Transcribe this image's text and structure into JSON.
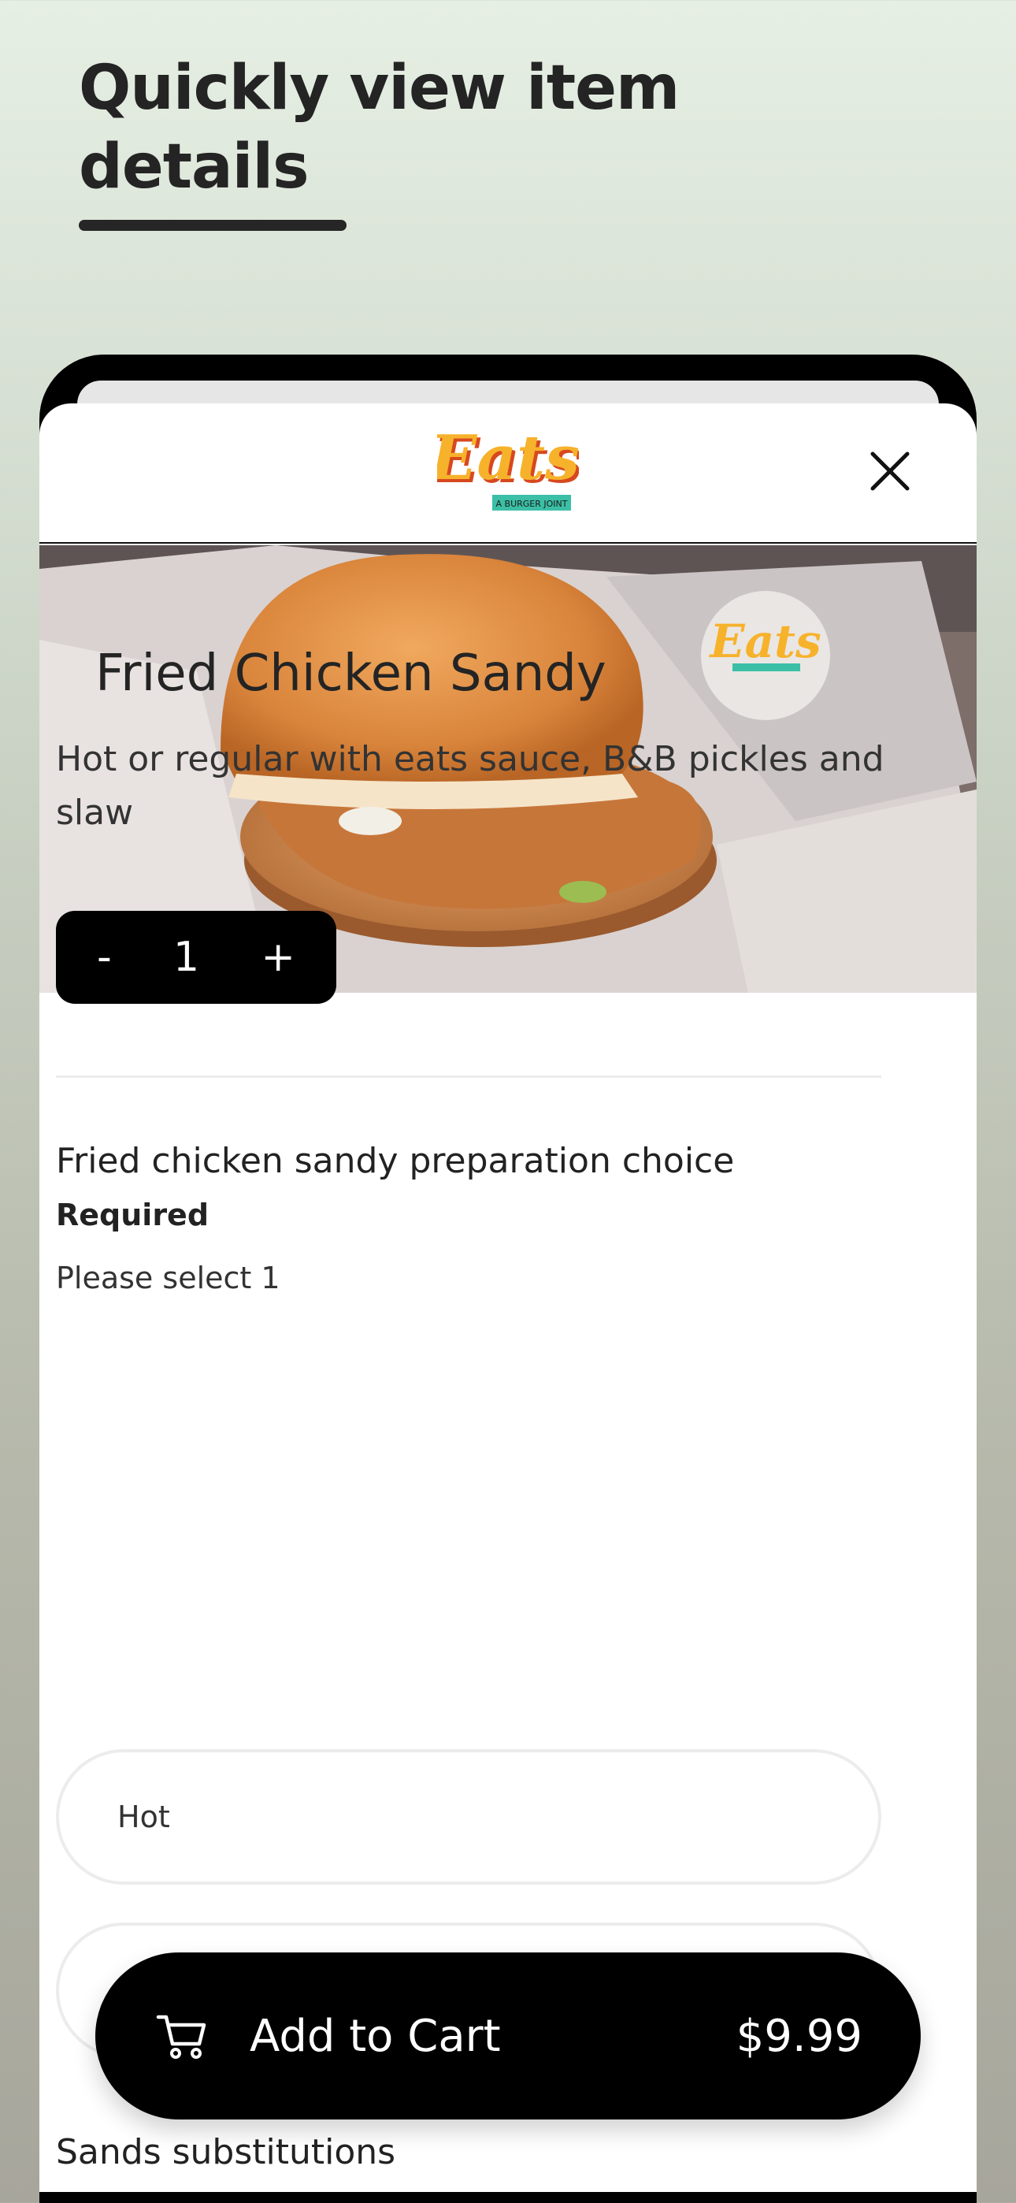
{
  "promo": {
    "heading": "Quickly view item details"
  },
  "brand": {
    "logo_text": "Eats",
    "logo_tagline": "A BURGER JOINT"
  },
  "item": {
    "title": "Fried Chicken Sandy",
    "description": "Hot or regular with eats sauce, B&B pickles and slaw",
    "image_alt": "Fried chicken sandwich photo"
  },
  "quantity": {
    "decrement_label": "-",
    "value": "1",
    "increment_label": "+"
  },
  "option_group": {
    "title": "Fried chicken sandy preparation choice",
    "required_label": "Required",
    "hint": "Please select 1",
    "options": [
      "Hot",
      ""
    ]
  },
  "next_group": {
    "title": "Sands substitutions"
  },
  "cart_button": {
    "label": "Add to Cart",
    "price": "$9.99",
    "icon": "cart-icon"
  },
  "colors": {
    "accent": "#000000",
    "logo_yellow": "#f7b22b",
    "logo_teal": "#3bbfa6"
  }
}
